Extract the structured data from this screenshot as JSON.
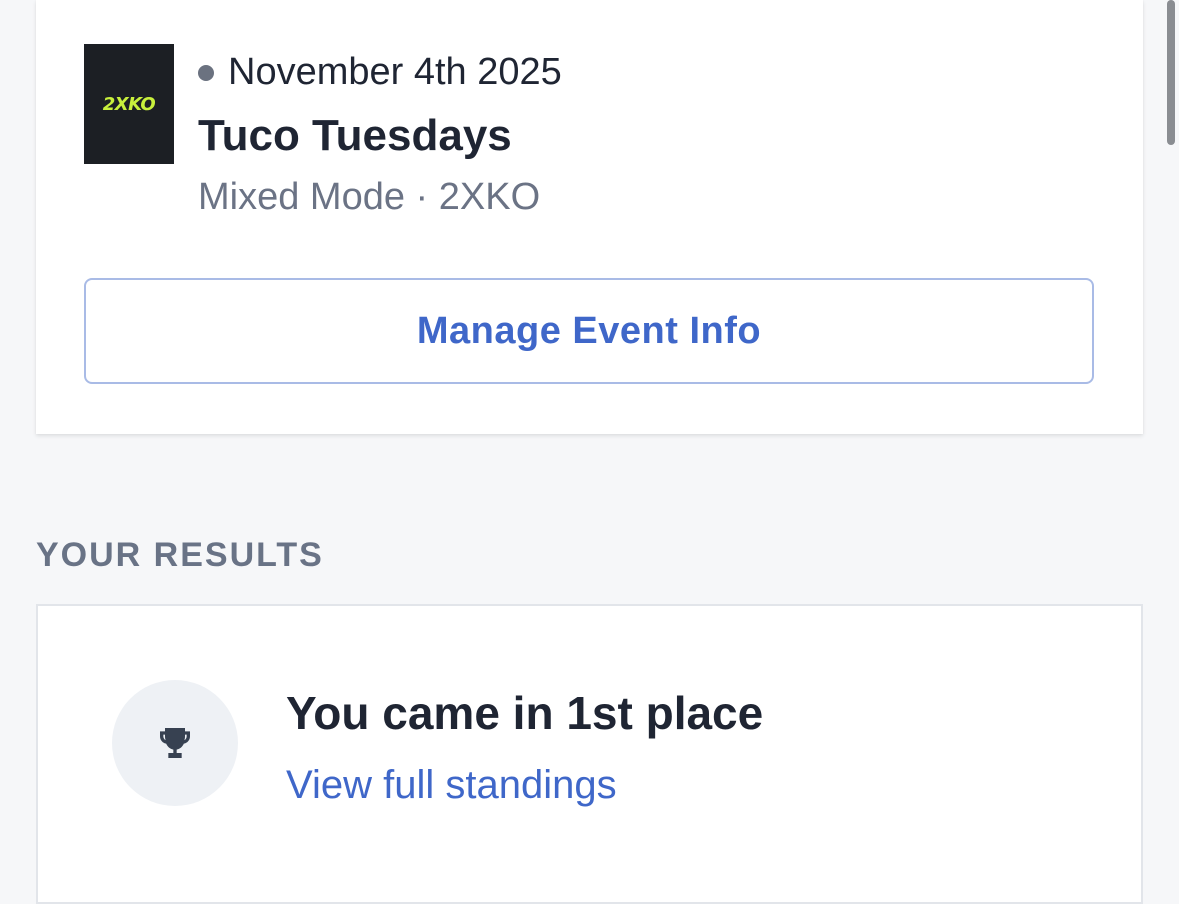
{
  "event": {
    "logo_text": "2XKO",
    "date": "November 4th 2025",
    "title": "Tuco Tuesdays",
    "subtitle": "Mixed Mode · 2XKO",
    "manage_button_label": "Manage Event Info"
  },
  "results": {
    "section_heading": "YOUR RESULTS",
    "placement_text": "You came in 1st place",
    "standings_link": "View full standings",
    "icon": "trophy-icon"
  },
  "colors": {
    "accent": "#3f67c9",
    "logo_accent": "#c8f03c",
    "status_dot": "#6b7280"
  }
}
